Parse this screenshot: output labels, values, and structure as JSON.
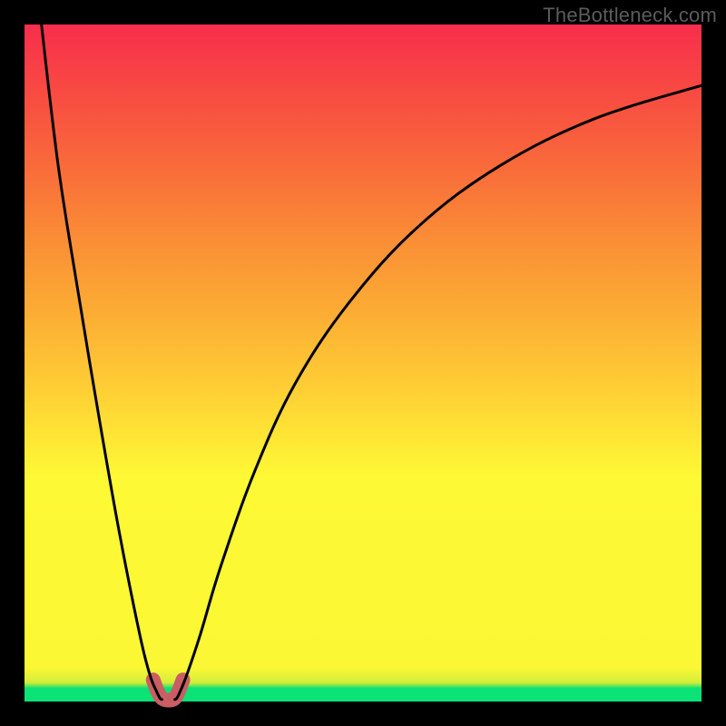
{
  "watermark": "TheBottleneck.com",
  "chart_data": {
    "type": "line",
    "title": "",
    "xlabel": "",
    "ylabel": "",
    "xlim": [
      0,
      100
    ],
    "ylim": [
      0,
      100
    ],
    "series": [
      {
        "name": "left-branch",
        "x": [
          2.5,
          5,
          8,
          11,
          14,
          17,
          18.5,
          19.5,
          20,
          20.3
        ],
        "y": [
          100,
          79,
          60,
          42,
          25,
          10,
          4,
          1.5,
          0.5,
          0.3
        ]
      },
      {
        "name": "right-branch",
        "x": [
          22.2,
          22.5,
          23,
          24,
          26,
          29,
          34,
          40,
          48,
          58,
          70,
          84,
          100
        ],
        "y": [
          0.3,
          0.5,
          1.5,
          4,
          10,
          20,
          34,
          47,
          59,
          70,
          79,
          86,
          91
        ]
      },
      {
        "name": "bottom-highlight",
        "x": [
          19.0,
          19.6,
          20.2,
          20.8,
          21.3,
          21.8,
          22.3,
          22.8,
          23.4
        ],
        "y": [
          3.2,
          1.6,
          0.6,
          0.25,
          0.2,
          0.25,
          0.6,
          1.6,
          3.2
        ]
      }
    ],
    "gradient_stops": [
      {
        "pos": 0.0,
        "color": "#0be376"
      },
      {
        "pos": 0.02,
        "color": "#0be376"
      },
      {
        "pos": 0.023,
        "color": "#69e655"
      },
      {
        "pos": 0.028,
        "color": "#d3ed3b"
      },
      {
        "pos": 0.05,
        "color": "#fbf734"
      },
      {
        "pos": 0.33,
        "color": "#fef935"
      },
      {
        "pos": 0.46,
        "color": "#fecf35"
      },
      {
        "pos": 0.56,
        "color": "#fcb134"
      },
      {
        "pos": 0.68,
        "color": "#fa8e36"
      },
      {
        "pos": 0.78,
        "color": "#f96e3a"
      },
      {
        "pos": 0.89,
        "color": "#f84d41"
      },
      {
        "pos": 1.0,
        "color": "#f72e4c"
      }
    ],
    "bottom_highlight_color": "#cb5e62",
    "curve_color": "#000000"
  }
}
